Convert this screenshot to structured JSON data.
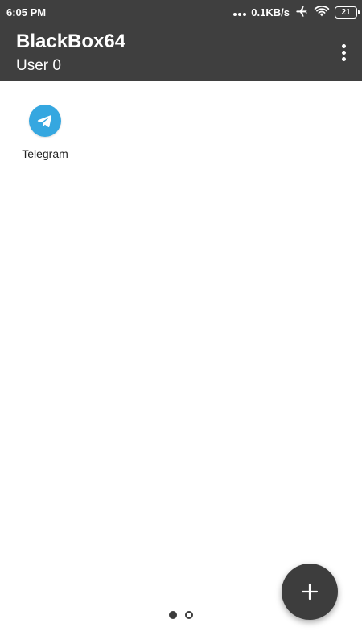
{
  "status_bar": {
    "time": "6:05 PM",
    "network_speed": "0.1KB/s",
    "battery_level": "21",
    "icons": [
      "signal-dots-icon",
      "airplane-icon",
      "wifi-icon",
      "battery-icon"
    ]
  },
  "app_bar": {
    "title": "BlackBox64",
    "subtitle": "User 0",
    "menu_icon": "overflow-menu-icon"
  },
  "apps": [
    {
      "label": "Telegram",
      "icon": "telegram-icon",
      "color": "#35a7e0"
    }
  ],
  "pager": {
    "total_pages": 2,
    "current_page": 1
  },
  "fab": {
    "icon": "plus-icon"
  },
  "colors": {
    "bar_background": "#3f3f3f",
    "telegram_blue": "#35a7e0",
    "fab_background": "#3d3d3d"
  }
}
